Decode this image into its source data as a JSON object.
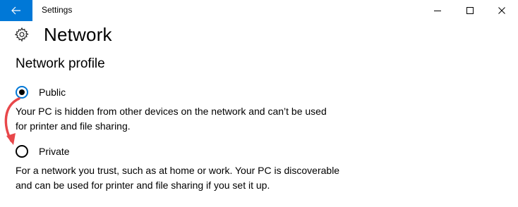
{
  "window": {
    "title": "Settings",
    "back_icon": "back-arrow-icon",
    "minimize_icon": "minimize-icon",
    "maximize_icon": "maximize-icon",
    "close_icon": "close-icon",
    "accent_color": "#0078d7"
  },
  "page": {
    "icon": "gear-icon",
    "title": "Network"
  },
  "network_profile": {
    "heading": "Network profile",
    "options": [
      {
        "label": "Public",
        "selected": true,
        "description": "Your PC is hidden from other devices on the network and can’t be used for printer and file sharing."
      },
      {
        "label": "Private",
        "selected": false,
        "description": "For a network you trust, such as at home or work. Your PC is discoverable and can be used for printer and file sharing if you set it up."
      }
    ]
  },
  "annotation": {
    "icon": "red-curved-arrow-icon",
    "color": "#e8474a"
  }
}
